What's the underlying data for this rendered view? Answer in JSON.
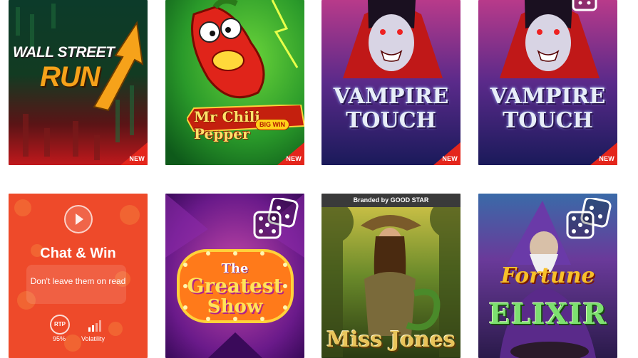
{
  "games": [
    {
      "title_line1": "WALL STREET",
      "title_line2": "RUN",
      "badge": "NEW"
    },
    {
      "title": "Mr Chili Pepper",
      "subtitle": "BIG WIN",
      "badge": "NEW"
    },
    {
      "title_line1": "VAMPIRE",
      "title_line2": "TOUCH",
      "badge": "NEW"
    },
    {
      "title_line1": "VAMPIRE",
      "title_line2": "TOUCH",
      "badge": "NEW"
    },
    {
      "title": "Chat & Win",
      "subtitle": "Don't leave them on read",
      "rtp_label": "RTP",
      "rtp_value": "95%",
      "volatility_label": "Volatility"
    },
    {
      "title_line1": "The",
      "title_line2": "Greatest",
      "title_line3": "Show"
    },
    {
      "branding": "Branded by GOOD STAR",
      "title": "Miss Jones"
    },
    {
      "title_line1": "Fortune",
      "title_line2": "ELIXIR"
    }
  ],
  "colors": {
    "badge_red": "#e4261c",
    "chat_orange": "#ee4a2a",
    "dice_white": "#ffffff"
  },
  "icons": {
    "play": "play-icon",
    "dice": "dice-icon",
    "volatility": "volatility-bars-icon"
  }
}
